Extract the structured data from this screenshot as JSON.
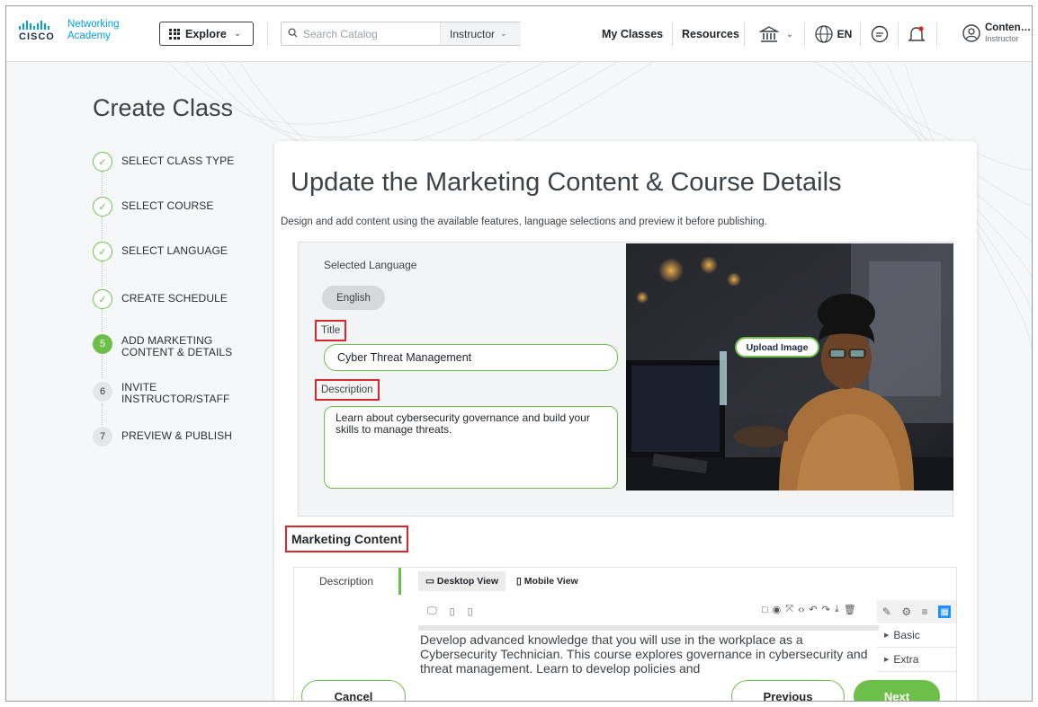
{
  "brand": {
    "line1": "Networking",
    "line2": "Academy",
    "wordmark": "CISCO"
  },
  "nav": {
    "explore_label": "Explore",
    "search_placeholder": "Search Catalog",
    "role_select": "Instructor",
    "links": [
      "My Classes",
      "Resources"
    ],
    "language": "EN",
    "user_name": "Content...",
    "user_role": "Instructor"
  },
  "page": {
    "title": "Create Class"
  },
  "steps": [
    {
      "num": "",
      "label": "SELECT CLASS TYPE",
      "status": "done"
    },
    {
      "num": "",
      "label": "SELECT COURSE",
      "status": "done"
    },
    {
      "num": "",
      "label": "SELECT LANGUAGE",
      "status": "done"
    },
    {
      "num": "",
      "label": "CREATE SCHEDULE",
      "status": "done"
    },
    {
      "num": "5",
      "label": "ADD MARKETING CONTENT & DETAILS",
      "status": "active"
    },
    {
      "num": "6",
      "label": "INVITE INSTRUCTOR/STAFF",
      "status": "todo"
    },
    {
      "num": "7",
      "label": "PREVIEW & PUBLISH",
      "status": "todo"
    }
  ],
  "card": {
    "heading": "Update the Marketing Content & Course Details",
    "subtitle": "Design and add content using the available features, language selections and preview it before publishing.",
    "selected_language_label": "Selected Language",
    "language_chip": "English",
    "title_label": "Title",
    "title_value": "Cyber Threat Management",
    "description_label": "Description",
    "description_value": "Learn about cybersecurity governance and build your skills to manage threats.",
    "upload_image_label": "Upload Image"
  },
  "marketing": {
    "heading": "Marketing Content",
    "side_tab": "Description",
    "view_tabs": [
      "Desktop View",
      "Mobile View"
    ],
    "body_text": "Develop advanced knowledge that you will use in the workplace as a Cybersecurity Technician. This course explores governance in cybersecurity and threat management. Learn to develop policies and",
    "blocks": [
      "Basic",
      "Extra"
    ]
  },
  "footer": {
    "cancel": "Cancel",
    "previous": "Previous",
    "next": "Next"
  },
  "colors": {
    "accent_green": "#6cc04a",
    "highlight_red": "#d9272e",
    "cisco_blue": "#049fd9"
  }
}
